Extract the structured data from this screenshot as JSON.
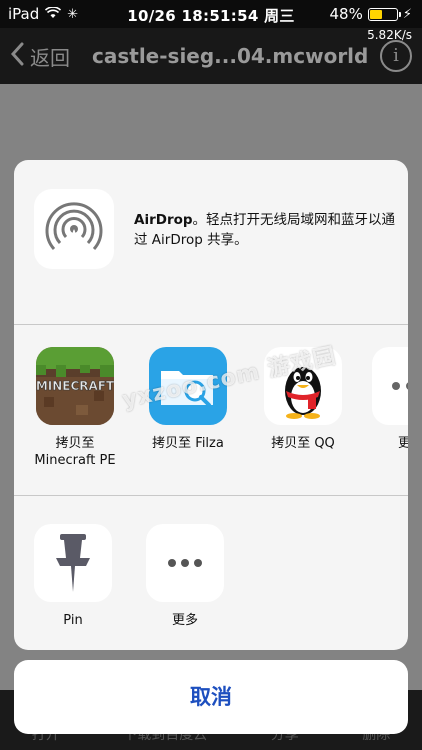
{
  "status_bar": {
    "device": "iPad",
    "datetime": "10/26 18:51:54 周三",
    "battery_percent": "48%",
    "battery_level": 0.48,
    "speed": "5.82K/s"
  },
  "nav": {
    "back_label": "返回",
    "title": "castle-sieg...04.mcworld",
    "info_icon": "info-icon"
  },
  "toolbar": {
    "items": [
      "打开",
      "下载到百度云",
      "分享",
      "删除"
    ]
  },
  "share_sheet": {
    "airdrop": {
      "title": "AirDrop",
      "description": "。轻点打开无线局域网和蓝牙以通过 AirDrop 共享。",
      "icon": "airdrop-icon"
    },
    "apps": [
      {
        "label": "拷贝至\nMinecraft PE",
        "icon": "minecraft-icon"
      },
      {
        "label": "拷贝至 Filza",
        "icon": "filza-icon"
      },
      {
        "label": "拷贝至 QQ",
        "icon": "qq-icon"
      },
      {
        "label": "更",
        "icon": "more-apps-icon"
      }
    ],
    "actions": [
      {
        "label": "Pin",
        "icon": "pin-icon"
      },
      {
        "label": "更多",
        "icon": "more-icon"
      }
    ],
    "cancel_label": "取消"
  },
  "watermark": "yxzoo.com 游戏园",
  "colors": {
    "accent": "#1d4fbf",
    "battery": "#ffd400",
    "filza_blue": "#2aa3e6"
  }
}
